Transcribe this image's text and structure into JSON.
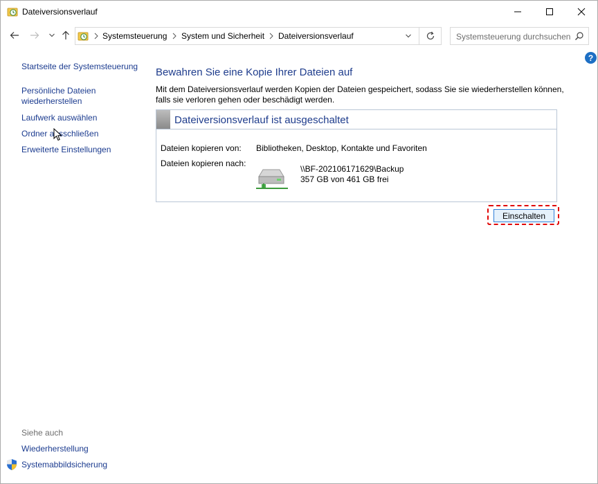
{
  "window": {
    "title": "Dateiversionsverlauf"
  },
  "addressbar": {
    "crumbs": [
      "Systemsteuerung",
      "System und Sicherheit",
      "Dateiversionsverlauf"
    ],
    "search_placeholder": "Systemsteuerung durchsuchen"
  },
  "sidebar": {
    "home_link": "Startseite der Systemsteuerung",
    "links": [
      "Persönliche Dateien wiederherstellen",
      "Laufwerk auswählen",
      "Ordner ausschließen",
      "Erweiterte Einstellungen"
    ],
    "see_also_label": "Siehe auch",
    "see_also_links": [
      "Wiederherstellung",
      "Systemabbildsicherung"
    ]
  },
  "main": {
    "heading": "Bewahren Sie eine Kopie Ihrer Dateien auf",
    "description": "Mit dem Dateiversionsverlauf werden Kopien der Dateien gespeichert, sodass Sie sie wiederherstellen können, falls sie verloren gehen oder beschädigt werden.",
    "status_title": "Dateiversionsverlauf ist ausgeschaltet",
    "copy_from_label": "Dateien kopieren von:",
    "copy_from_value": "Bibliotheken, Desktop, Kontakte und Favoriten",
    "copy_to_label": "Dateien kopieren nach:",
    "drive_path": "\\\\BF-202106171629\\Backup",
    "drive_free": "357 GB von 461 GB frei",
    "enable_button": "Einschalten"
  },
  "colors": {
    "link": "#1b3b8f",
    "heading": "#1e3c8c",
    "highlight": "#e00000"
  }
}
